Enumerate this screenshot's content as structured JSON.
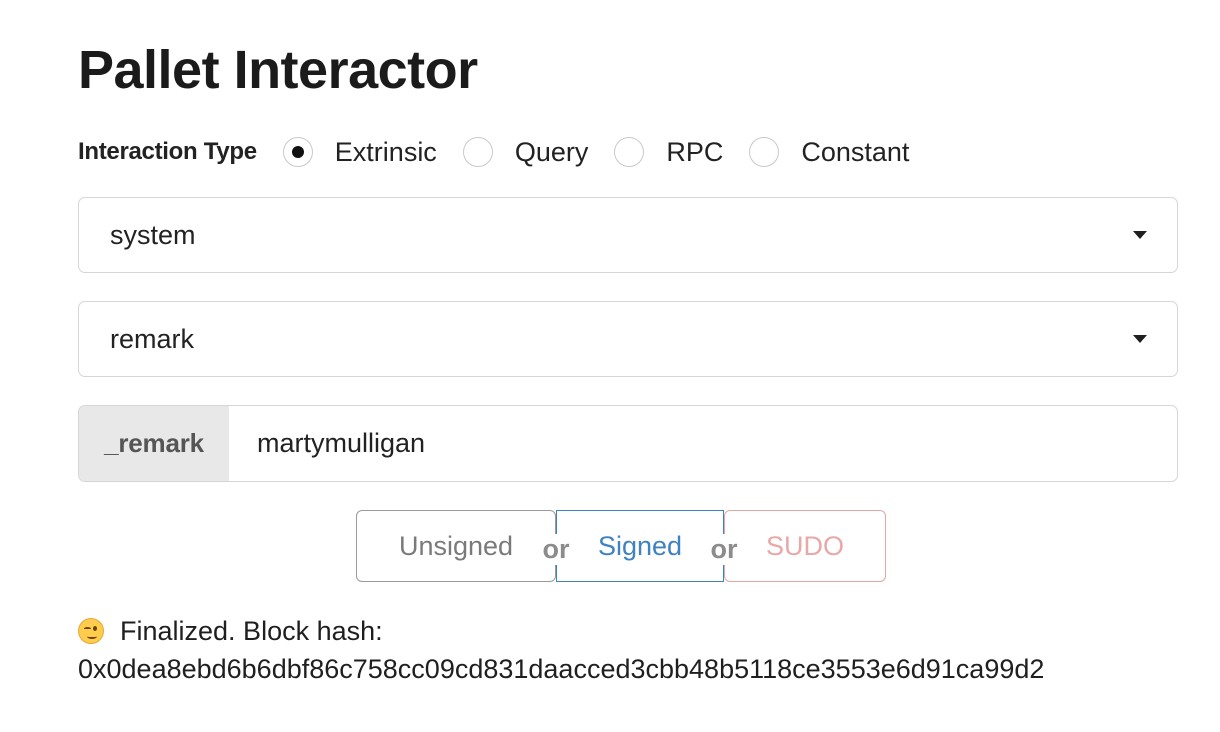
{
  "page": {
    "title": "Pallet Interactor"
  },
  "interaction_type": {
    "label": "Interaction Type",
    "options": [
      "Extrinsic",
      "Query",
      "RPC",
      "Constant"
    ],
    "selected": "Extrinsic"
  },
  "pallet_select": {
    "value": "system"
  },
  "call_select": {
    "value": "remark"
  },
  "param": {
    "label": "_remark",
    "value": "martymulligan"
  },
  "buttons": {
    "unsigned": "Unsigned",
    "signed": "Signed",
    "sudo": "SUDO",
    "separator": "or"
  },
  "status": {
    "icon": "winking-face-icon",
    "text": "Finalized. Block hash:",
    "hash": "0x0dea8ebd6b6dbf86c758cc09cd831daacced3cbb48b5118ce3553e6d91ca99d2"
  },
  "colors": {
    "signed": "#3e82c4",
    "sudo": "#e9a8a8",
    "unsigned": "#7a7a7a"
  }
}
